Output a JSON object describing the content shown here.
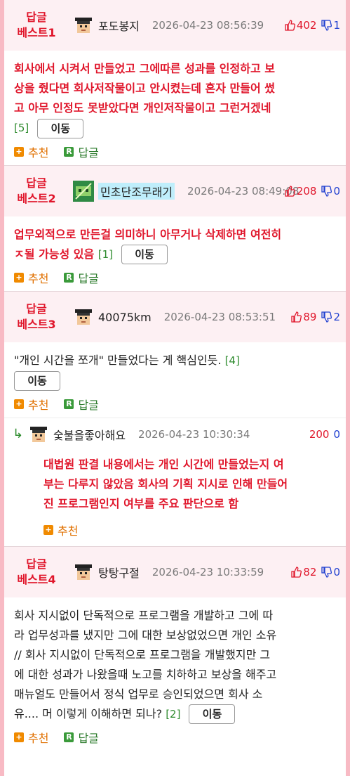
{
  "comments": [
    {
      "badge1": "답글",
      "badge2": "베스트1",
      "nick": "포도봉지",
      "date": "2026-04-23 08:56:39",
      "up": "402",
      "down": "1",
      "lines": [
        "회사에서 시켜서 만들었고 그에따른 성과를 인정하고 보",
        "상을 줬다면 회사저작물이고 안시켰는데 혼자 만들어 썼",
        "고 아무 인정도 못받았다면 개인저작물이고 그런거겠네"
      ],
      "count": "[5]",
      "move": "이동",
      "recommend": "추천",
      "reply": "답글"
    },
    {
      "badge1": "답글",
      "badge2": "베스트2",
      "nick": "민초단조무래기",
      "date": "2026-04-23 08:49:08",
      "up": "208",
      "down": "0",
      "lines": [
        "업무외적으로 만든걸 의미하니 아무거나 삭제하면 여전히",
        "ㅈ될 가능성 있음"
      ],
      "count": "[1]",
      "move": "이동",
      "recommend": "추천",
      "reply": "답글"
    },
    {
      "badge1": "답글",
      "badge2": "베스트3",
      "nick": "40075km",
      "date": "2026-04-23 08:53:51",
      "up": "89",
      "down": "2",
      "lines": [
        "\"개인 시간을 쪼개\" 만들었다는 게 핵심인듯."
      ],
      "count": "[4]",
      "move": "이동",
      "recommend": "추천",
      "reply": "답글"
    },
    {
      "badge1": "답글",
      "badge2": "베스트4",
      "nick": "탕탕구절",
      "date": "2026-04-23 10:33:59",
      "up": "82",
      "down": "0",
      "lines": [
        "회사 지시없이 단독적으로 프로그램을 개발하고 그에 따",
        "라 업무성과를 냈지만 그에 대한 보상없었으면 개인 소유",
        "// 회사 지시없이 단독적으로 프로그램을 개발했지만 그",
        "에 대한 성과가 나왔을때 노고를 치하하고 보상을 해주고",
        "매뉴얼도 만들어서 정식 업무로 승인되었으면 회사 소",
        "유.... 머 이렇게 이해하면 되나?"
      ],
      "count": "[2]",
      "move": "이동",
      "recommend": "추천",
      "reply": "답글"
    }
  ],
  "child": {
    "nick": "숯불을좋아해요",
    "date": "2026-04-23 10:30:34",
    "up": "200",
    "down": "0",
    "lines": [
      "대법원 판결 내용에서는 개인 시간에 만들었는지 여",
      "부는 다루지 않았음 회사의 기획 지시로 인해 만들어",
      "진 프로그램인지 여부를 주요 판단으로 함"
    ],
    "recommend": "추천"
  }
}
